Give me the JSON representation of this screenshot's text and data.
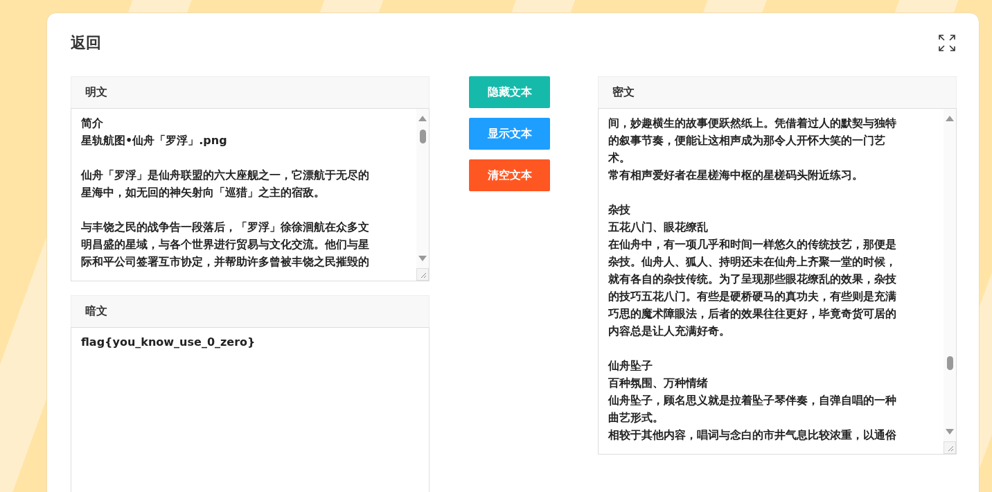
{
  "page": {
    "back_title": "返回"
  },
  "plaintext": {
    "label": "明文",
    "paragraphs": [
      {
        "lines": [
          "简介",
          "星轨航图•仙舟「罗浮」.png"
        ]
      },
      {
        "lines": [
          "仙舟「罗浮」是仙舟联盟的六大座舰之一，它漂航于无尽的",
          "星海中，如无回的神矢射向「巡猎」之主的宿敌。"
        ]
      },
      {
        "lines": [
          "与丰饶之民的战争告一段落后，「罗浮」徐徐洄航在众多文",
          "明昌盛的星域，与各个世界进行贸易与文化交流。他们与星",
          "际和平公司签署互市协定，并帮助许多曾被丰饶之民摧毁的"
        ]
      }
    ]
  },
  "hidden_text": {
    "label": "暗文",
    "value": "flag{you_know_use_0_zero}"
  },
  "buttons": [
    {
      "label": "隐藏文本",
      "color": "#16baaa"
    },
    {
      "label": "显示文本",
      "color": "#1e9fff"
    },
    {
      "label": "清空文本",
      "color": "#ff5722"
    }
  ],
  "ciphertext": {
    "label": "密文",
    "paragraphs": [
      {
        "lines": [
          "间，妙趣横生的故事便跃然纸上。凭借着过人的默契与独特",
          "的叙事节奏，便能让这相声成为那令人开怀大笑的一门艺",
          "术。",
          "常有相声爱好者在星槎海中枢的星槎码头附近练习。"
        ]
      },
      {
        "lines": [
          "杂技",
          "五花八门、眼花缭乱",
          "在仙舟中，有一项几乎和时间一样悠久的传统技艺，那便是",
          "杂技。仙舟人、狐人、持明还未在仙舟上齐聚一堂的时候，",
          "就有各自的杂技传统。为了呈现那些眼花缭乱的效果，杂技",
          "的技巧五花八门。有些是硬桥硬马的真功夫，有些则是充满",
          "巧思的魔术障眼法，后者的效果往往更好，毕竟奇货可居的",
          "内容总是让人充满好奇。"
        ]
      },
      {
        "lines": [
          "仙舟坠子",
          "百种氛围、万种情绪",
          "仙舟坠子，顾名思义就是拉着坠子琴伴奏，自弹自唱的一种",
          "曲艺形式。",
          "相较于其他内容，唱词与念白的市井气息比较浓重，以通俗"
        ]
      }
    ]
  }
}
